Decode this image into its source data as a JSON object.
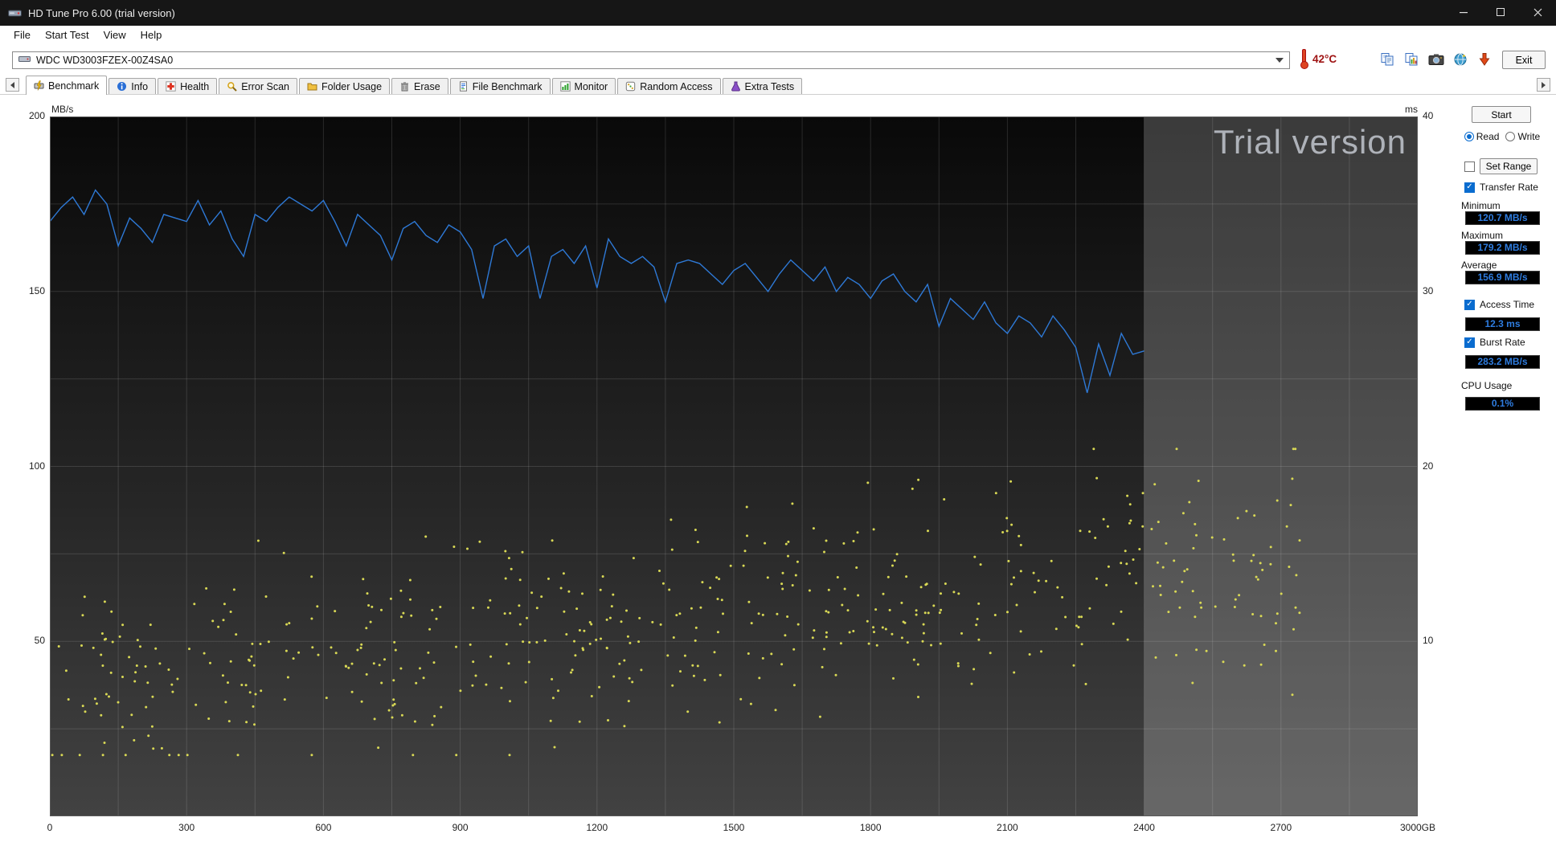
{
  "window": {
    "title": "HD Tune Pro 6.00 (trial version)"
  },
  "menu": [
    "File",
    "Start Test",
    "View",
    "Help"
  ],
  "toolbar": {
    "drive_selector": "WDC WD3003FZEX-00Z4SA0",
    "temperature": "42°C",
    "icons": [
      "copy-text-icon",
      "copy-image-icon",
      "screenshot-icon",
      "web-icon",
      "download-icon"
    ],
    "exit_label": "Exit"
  },
  "tabs": [
    {
      "label": "Benchmark",
      "icon": "benchmark-icon",
      "active": true
    },
    {
      "label": "Info",
      "icon": "info-icon",
      "active": false
    },
    {
      "label": "Health",
      "icon": "health-icon",
      "active": false
    },
    {
      "label": "Error Scan",
      "icon": "error-scan-icon",
      "active": false
    },
    {
      "label": "Folder Usage",
      "icon": "folder-usage-icon",
      "active": false
    },
    {
      "label": "Erase",
      "icon": "erase-icon",
      "active": false
    },
    {
      "label": "File Benchmark",
      "icon": "file-benchmark-icon",
      "active": false
    },
    {
      "label": "Monitor",
      "icon": "monitor-icon",
      "active": false
    },
    {
      "label": "Random Access",
      "icon": "random-access-icon",
      "active": false
    },
    {
      "label": "Extra Tests",
      "icon": "extra-tests-icon",
      "active": false
    }
  ],
  "chart_data": {
    "type": "line+scatter",
    "watermark": "Trial version",
    "x_axis": {
      "unit": "GB",
      "min": 0,
      "max": 3000,
      "tick_step": 300,
      "grid_step": 150,
      "ticks": [
        0,
        300,
        600,
        900,
        1200,
        1500,
        1800,
        2100,
        2400,
        2700
      ],
      "end_label": "3000GB"
    },
    "left_axis": {
      "unit": "MB/s",
      "min": 0,
      "max": 200,
      "tick_step": 50,
      "grid_step": 25,
      "ticks": [
        200,
        150,
        100,
        50
      ]
    },
    "right_axis": {
      "unit": "ms",
      "min": 0,
      "max": 40,
      "tick_step": 10,
      "ticks": [
        40,
        30,
        20,
        10
      ]
    },
    "tested_up_to_gb": 2400,
    "series": [
      {
        "name": "Transfer Rate",
        "type": "line",
        "axis": "left",
        "unit": "MB/s",
        "color": "#2e79d6",
        "x_start": 0,
        "x_step": 25,
        "values": [
          170,
          174,
          177,
          172,
          179,
          175,
          163,
          171,
          168,
          164,
          172,
          171,
          170,
          176,
          169,
          173,
          165,
          160,
          172,
          170,
          174,
          177,
          175,
          173,
          176,
          170,
          163,
          172,
          169,
          166,
          159,
          168,
          170,
          166,
          164,
          169,
          167,
          162,
          148,
          163,
          165,
          160,
          163,
          148,
          160,
          162,
          158,
          163,
          151,
          165,
          160,
          158,
          160,
          157,
          147,
          158,
          159,
          158,
          155,
          152,
          156,
          158,
          154,
          150,
          155,
          159,
          156,
          153,
          157,
          150,
          154,
          152,
          148,
          153,
          155,
          150,
          147,
          152,
          140,
          148,
          145,
          142,
          147,
          141,
          138,
          143,
          141,
          137,
          143,
          139,
          134,
          121,
          135,
          126,
          138,
          132,
          133
        ]
      },
      {
        "name": "Access Time",
        "type": "scatter",
        "axis": "right",
        "unit": "ms",
        "color": "#d9d955",
        "generator": {
          "seed": 1234567,
          "count": 560,
          "x_min": 5,
          "x_max": 2750,
          "base": 7.2,
          "trend": 8.5,
          "spread": 9,
          "clamp_min": 3.5,
          "clamp_max": 21
        }
      }
    ],
    "summary": {
      "minimum": "120.7 MB/s",
      "maximum": "179.2 MB/s",
      "average": "156.9 MB/s",
      "access_time": "12.3 ms",
      "burst_rate": "283.2 MB/s",
      "cpu_usage": "0.1%"
    }
  },
  "side_panel": {
    "start_button": "Start",
    "read_label": "Read",
    "write_label": "Write",
    "read_selected": true,
    "set_range_button": "Set Range",
    "set_range_checked": false,
    "transfer_rate": {
      "label": "Transfer Rate",
      "checked": true,
      "minimum_label": "Minimum",
      "minimum_value": "120.7 MB/s",
      "maximum_label": "Maximum",
      "maximum_value": "179.2 MB/s",
      "average_label": "Average",
      "average_value": "156.9 MB/s"
    },
    "access_time": {
      "label": "Access Time",
      "checked": true,
      "value": "12.3 ms"
    },
    "burst_rate": {
      "label": "Burst Rate",
      "checked": true,
      "value": "283.2 MB/s"
    },
    "cpu_usage": {
      "label": "CPU Usage",
      "value": "0.1%"
    }
  },
  "colors": {
    "value_text": "#2e7cdf",
    "temperature_text": "#9e1212"
  }
}
